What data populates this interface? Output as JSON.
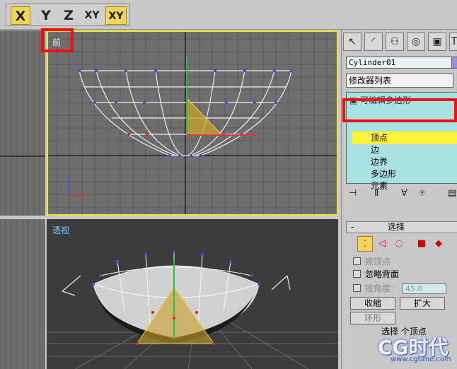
{
  "toolbar": {
    "axis_x": "X",
    "axis_y": "Y",
    "axis_z": "Z",
    "axis_xy": "XY",
    "axis_xy_lock": "XY"
  },
  "viewports": {
    "front_label": "前",
    "perspective_label": "透视"
  },
  "panel": {
    "object_name": "Cylinder01",
    "modifier_list": "修改器列表",
    "stack_header": "可编辑多边形",
    "stack_items": [
      "顶点",
      "边",
      "边界",
      "多边形",
      "元素"
    ],
    "selection_rollout": "选择",
    "rollout_sign": "-",
    "by_vertex": "按顶点",
    "ignore_backfacing": "忽略背面",
    "by_angle": "按角度:",
    "angle_value": "45.0",
    "shrink_btn": "收缩",
    "grow_btn": "扩大",
    "ring_btn": "环形",
    "selected_count": "选择 个顶点"
  },
  "watermark": {
    "brand": "CG时代",
    "url": "www.cgtime.com"
  },
  "colors": {
    "highlight": "#fff23a",
    "accent_yellow": "#f3d35a",
    "annotation_red": "#ee1111",
    "viewport_bg": "#6e6e6e",
    "active_viewport_border": "#f0e040"
  }
}
